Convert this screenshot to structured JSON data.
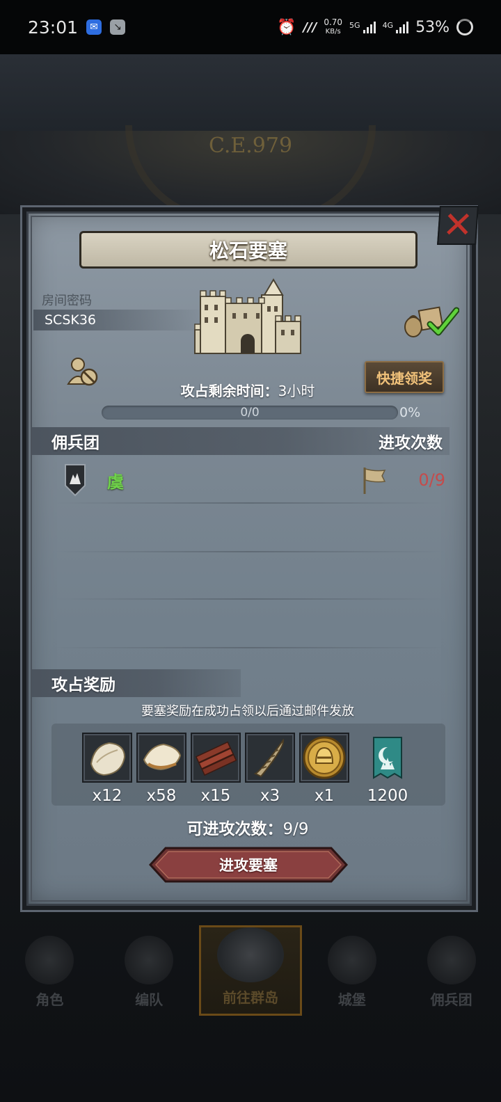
{
  "status_bar": {
    "time": "23:01",
    "speed_value": "0.70",
    "speed_unit": "KB/s",
    "net1": "5G",
    "net2": "4G",
    "battery": "53%"
  },
  "background": {
    "era_text": "C.E.979"
  },
  "dialog": {
    "title": "松石要塞",
    "room_label": "房间密码",
    "room_code": "SCSK36",
    "quick_claim_label": "快捷领奖",
    "time_left_label": "攻占剩余时间：",
    "time_left_value": "3小时",
    "progress_text": "0/0",
    "progress_percent": "0%",
    "progress_fraction": 0,
    "merc_header": "佣兵团",
    "attack_count_header": "进攻次数",
    "mercenaries": [
      {
        "name": "虞",
        "attacks": "0/9"
      }
    ],
    "reward_header": "攻占奖励",
    "reward_note": "要塞奖励在成功占领以后通过邮件发放",
    "rewards": [
      {
        "icon": "fur-pelt-icon",
        "qty": "x12"
      },
      {
        "icon": "white-fur-icon",
        "qty": "x58"
      },
      {
        "icon": "wood-planks-icon",
        "qty": "x15"
      },
      {
        "icon": "horn-icon",
        "qty": "x3"
      },
      {
        "icon": "golden-helmet-coin-icon",
        "qty": "x1"
      },
      {
        "icon": "guild-banner-icon",
        "qty": "1200"
      }
    ],
    "attacks_available_label": "可进攻次数：",
    "attacks_available_value": "9/9",
    "attack_button_label": "进攻要塞"
  },
  "bottom_nav": [
    {
      "label": "角色"
    },
    {
      "label": "编队"
    },
    {
      "label": "前往群岛"
    },
    {
      "label": "城堡"
    },
    {
      "label": "佣兵团"
    }
  ],
  "colors": {
    "accent_gold": "#f1c27a",
    "merc_green": "#6fd24a",
    "count_red": "#c54b4b",
    "close_red": "#c0322b"
  }
}
